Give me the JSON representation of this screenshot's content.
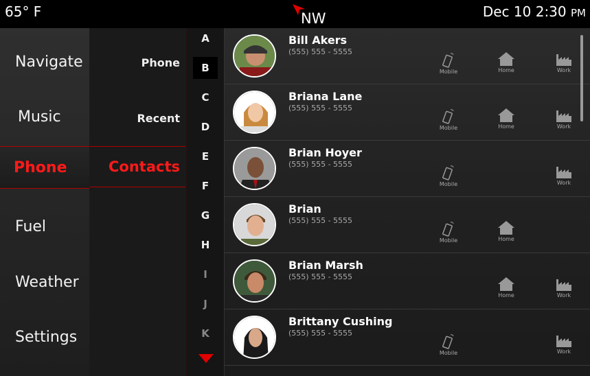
{
  "status": {
    "temperature": "65° F",
    "heading": "NW",
    "date": "Dec 10",
    "time": "2:30",
    "ampm": "PM"
  },
  "main_nav": [
    {
      "label": "Navigate",
      "active": false
    },
    {
      "label": "Music",
      "active": false
    },
    {
      "label": "Phone",
      "active": true
    },
    {
      "label": "Fuel",
      "active": false
    },
    {
      "label": "Weather",
      "active": false
    },
    {
      "label": "Settings",
      "active": false
    }
  ],
  "sub_nav": [
    {
      "label": "Phone",
      "active": false
    },
    {
      "label": "Recent",
      "active": false
    },
    {
      "label": "Contacts",
      "active": true
    }
  ],
  "alphabet": [
    "A",
    "B",
    "C",
    "D",
    "E",
    "F",
    "G",
    "H",
    "I",
    "J",
    "K"
  ],
  "alphabet_selected": "B",
  "action_labels": {
    "mobile": "Mobile",
    "home": "Home",
    "work": "Work"
  },
  "contacts": [
    {
      "name": "Bill Akers",
      "phone": "(555) 555 - 5555",
      "actions": [
        "mobile",
        "home",
        "work"
      ]
    },
    {
      "name": "Briana Lane",
      "phone": "(555) 555 - 5555",
      "actions": [
        "mobile",
        "home",
        "work"
      ]
    },
    {
      "name": "Brian Hoyer",
      "phone": "(555) 555 - 5555",
      "actions": [
        "mobile",
        "work"
      ]
    },
    {
      "name": "Brian",
      "phone": "(555) 555 - 5555",
      "actions": [
        "mobile",
        "home"
      ]
    },
    {
      "name": "Brian Marsh",
      "phone": "(555) 555 - 5555",
      "actions": [
        "home",
        "work"
      ]
    },
    {
      "name": "Brittany Cushing",
      "phone": "(555) 555 - 5555",
      "actions": [
        "mobile",
        "work"
      ]
    }
  ],
  "colors": {
    "accent": "#ff1a1a",
    "accent_dark": "#b30000",
    "background": "#000000"
  },
  "icons": {
    "heading": "compass-arrow-icon",
    "scroll_down": "triangle-down-icon",
    "mobile": "mobile-phone-icon",
    "home": "house-icon",
    "work": "factory-icon"
  }
}
